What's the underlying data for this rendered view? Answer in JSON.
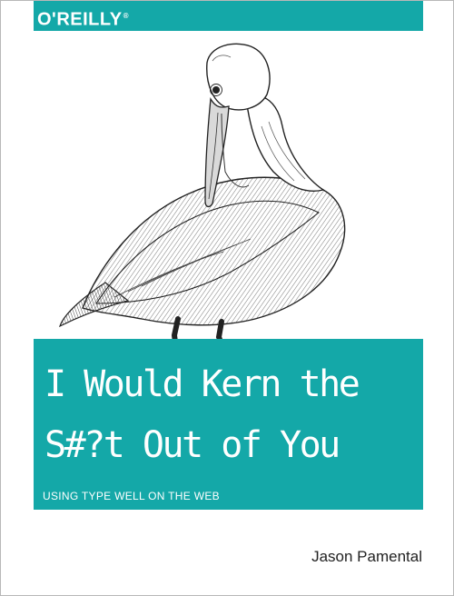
{
  "publisher": {
    "logo_text": "O'REILLY",
    "registered_mark": "®"
  },
  "cover_art": {
    "subject": "pelican-engraving"
  },
  "title": {
    "line1": "I Would Kern the",
    "line2": "S#?t Out of You"
  },
  "subtitle": "USING TYPE WELL ON THE WEB",
  "author": "Jason Pamental",
  "colors": {
    "accent": "#14a8a8",
    "text_on_accent": "#ffffff",
    "author_text": "#222222"
  }
}
